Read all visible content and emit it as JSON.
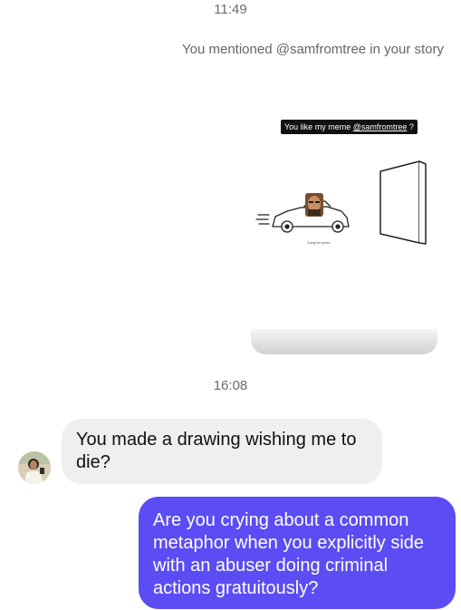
{
  "messages": {
    "time_top": "11:49",
    "story_caption": "You mentioned @samfromtree in your story",
    "story": {
      "meme_text_prefix": "You like my meme ",
      "meme_mention": "@samfromtree",
      "meme_text_suffix": " ?",
      "car_caption": "Going full speed"
    },
    "time_mid": "16:08",
    "incoming_text": "You made a drawing wishing me to die?",
    "outgoing_text": "Are you crying about a common metaphor when you explicitly side with an abuser doing criminal actions gratuitously?"
  },
  "colors": {
    "outgoing_bubble": "#5b4cf3",
    "incoming_bubble": "#efefef",
    "timestamp_text": "#6b6b6b"
  },
  "icons": {
    "avatar": "user-avatar",
    "story_drawing": "car-driving-into-wall-drawing"
  }
}
